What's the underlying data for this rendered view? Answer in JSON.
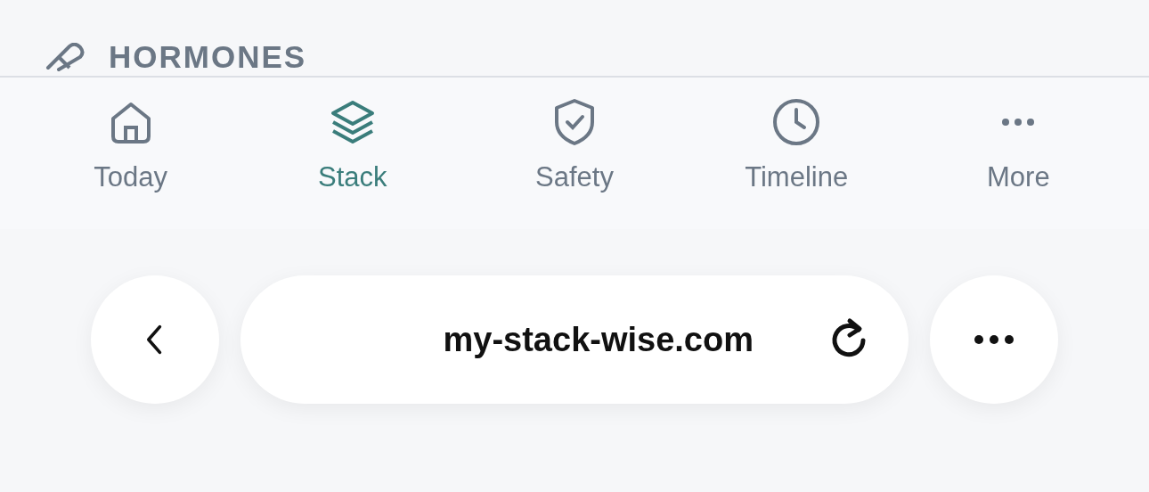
{
  "section": {
    "title": "HORMONES"
  },
  "tabs": [
    {
      "label": "Today",
      "kind": "home",
      "selected": false
    },
    {
      "label": "Stack",
      "kind": "layers",
      "selected": true
    },
    {
      "label": "Safety",
      "kind": "shield",
      "selected": false
    },
    {
      "label": "Timeline",
      "kind": "clock",
      "selected": false
    },
    {
      "label": "More",
      "kind": "dots",
      "selected": false
    }
  ],
  "browser": {
    "url": "my-stack-wise.com"
  }
}
